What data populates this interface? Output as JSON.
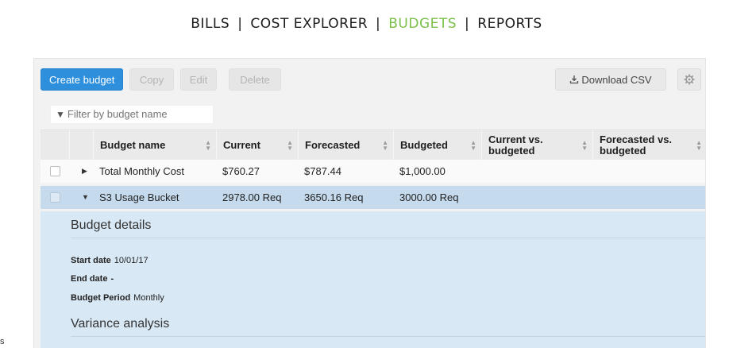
{
  "nav": {
    "items": [
      "BILLS",
      "COST EXPLORER",
      "BUDGETS",
      "REPORTS"
    ],
    "separator": "|",
    "active": "BUDGETS",
    "active_color": "#7cc04a"
  },
  "toolbar": {
    "create_label": "Create budget",
    "copy_label": "Copy",
    "edit_label": "Edit",
    "delete_label": "Delete",
    "download_label": "Download CSV",
    "download_icon": "download-icon",
    "settings_icon": "gear-icon",
    "primary_color": "#2e8fdd"
  },
  "filter": {
    "placeholder": "Filter by budget name",
    "icon": "filter-icon"
  },
  "table": {
    "columns": [
      {
        "label": "Budget name"
      },
      {
        "label": "Current"
      },
      {
        "label": "Forecasted"
      },
      {
        "label": "Budgeted"
      },
      {
        "label": "Current vs. budgeted"
      },
      {
        "label": "Forecasted vs. budgeted"
      }
    ],
    "rows": [
      {
        "name": "Total Monthly Cost",
        "current": "$760.27",
        "forecasted": "$787.44",
        "budgeted": "$1,000.00",
        "current_vs": "",
        "forecasted_vs": "",
        "expanded": false
      },
      {
        "name": "S3 Usage Bucket",
        "current": "2978.00 Req",
        "forecasted": "3650.16 Req",
        "budgeted": "3000.00 Req",
        "current_vs": "",
        "forecasted_vs": "",
        "expanded": true
      }
    ],
    "selected_row_color": "#c5daec"
  },
  "details": {
    "budget_details_title": "Budget details",
    "start_label": "Start date",
    "start_value": "10/01/17",
    "end_label": "End date",
    "end_value": "-",
    "period_label": "Budget Period",
    "period_value": "Monthly",
    "variance_title": "Variance analysis"
  },
  "stray_char": "s"
}
